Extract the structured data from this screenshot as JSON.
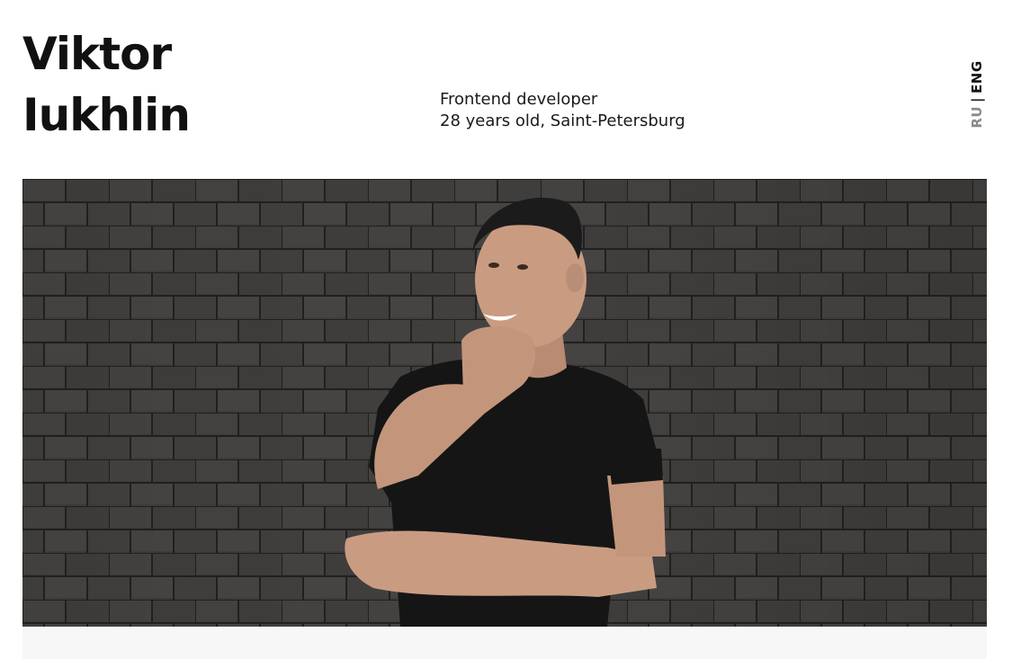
{
  "header": {
    "name_line1": "Viktor",
    "name_line2": "Iukhlin",
    "role": "Frontend developer",
    "details": "28 years old, Saint-Petersburg"
  },
  "language_switch": {
    "ru_label": "RU",
    "separator": "|",
    "eng_label": "ENG",
    "active": "ENG"
  },
  "photo": {
    "subject": "portrait of man in black t-shirt in front of dark brick wall"
  },
  "colors": {
    "text": "#111111",
    "inactive_lang": "#8a8a8a",
    "brick": "#3d3b39",
    "mortar": "#1f1e1d",
    "shirt": "#151515",
    "skin": "#c99c82"
  }
}
